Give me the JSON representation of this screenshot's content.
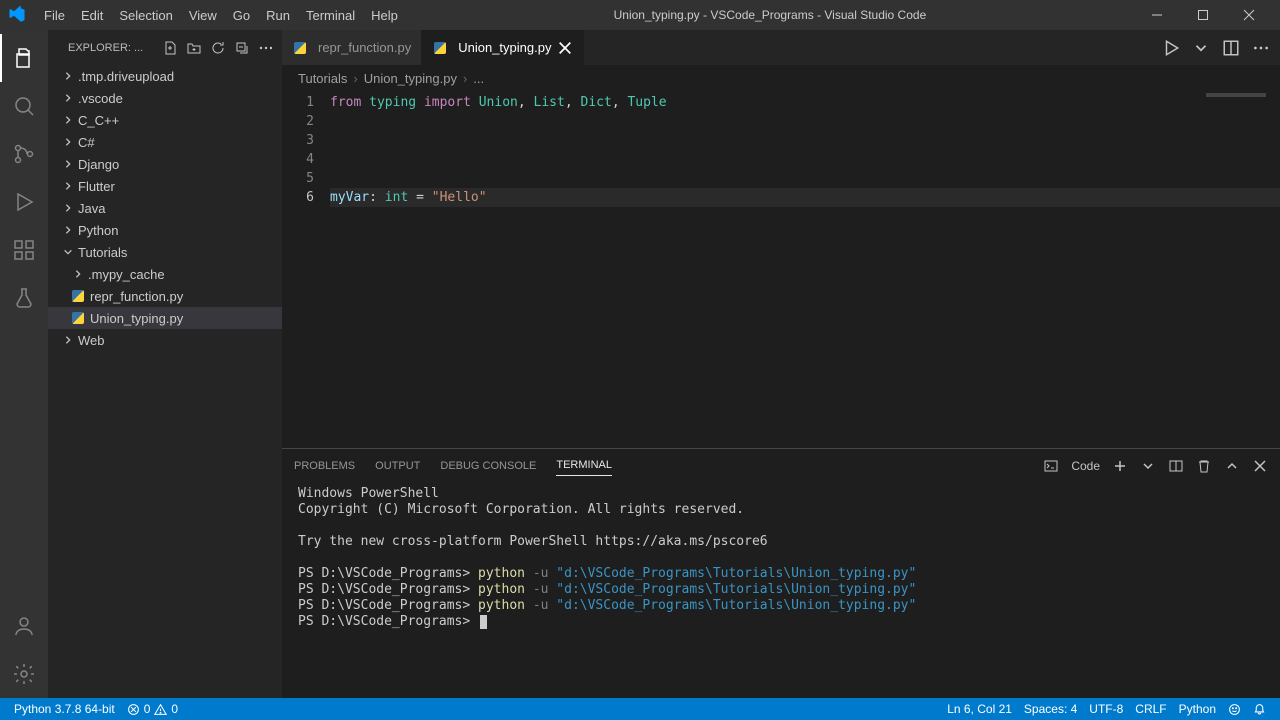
{
  "window": {
    "title": "Union_typing.py - VSCode_Programs - Visual Studio Code"
  },
  "menu": [
    "File",
    "Edit",
    "Selection",
    "View",
    "Go",
    "Run",
    "Terminal",
    "Help"
  ],
  "explorer": {
    "title": "EXPLORER: ...",
    "items": [
      {
        "label": ".tmp.driveupload",
        "type": "folder",
        "depth": 0,
        "expanded": false
      },
      {
        "label": ".vscode",
        "type": "folder",
        "depth": 0,
        "expanded": false
      },
      {
        "label": "C_C++",
        "type": "folder",
        "depth": 0,
        "expanded": false
      },
      {
        "label": "C#",
        "type": "folder",
        "depth": 0,
        "expanded": false
      },
      {
        "label": "Django",
        "type": "folder",
        "depth": 0,
        "expanded": false
      },
      {
        "label": "Flutter",
        "type": "folder",
        "depth": 0,
        "expanded": false
      },
      {
        "label": "Java",
        "type": "folder",
        "depth": 0,
        "expanded": false
      },
      {
        "label": "Python",
        "type": "folder",
        "depth": 0,
        "expanded": false
      },
      {
        "label": "Tutorials",
        "type": "folder",
        "depth": 0,
        "expanded": true
      },
      {
        "label": ".mypy_cache",
        "type": "folder",
        "depth": 1,
        "expanded": false
      },
      {
        "label": "repr_function.py",
        "type": "file-py",
        "depth": 1
      },
      {
        "label": "Union_typing.py",
        "type": "file-py",
        "depth": 1,
        "selected": true
      },
      {
        "label": "Web",
        "type": "folder",
        "depth": 0,
        "expanded": false
      }
    ]
  },
  "tabs": [
    {
      "label": "repr_function.py",
      "active": false,
      "icon": "py"
    },
    {
      "label": "Union_typing.py",
      "active": true,
      "icon": "py"
    }
  ],
  "breadcrumbs": [
    "Tutorials",
    "Union_typing.py",
    "..."
  ],
  "code": {
    "lines": [
      {
        "n": 1,
        "tokens": [
          [
            "from",
            "kw"
          ],
          [
            " ",
            "p"
          ],
          [
            "typing",
            "mod"
          ],
          [
            " ",
            "p"
          ],
          [
            "import",
            "kw"
          ],
          [
            " ",
            "p"
          ],
          [
            "Union",
            "mod"
          ],
          [
            ", ",
            "p"
          ],
          [
            "List",
            "mod"
          ],
          [
            ", ",
            "p"
          ],
          [
            "Dict",
            "mod"
          ],
          [
            ", ",
            "p"
          ],
          [
            "Tuple",
            "mod"
          ]
        ]
      },
      {
        "n": 2,
        "tokens": []
      },
      {
        "n": 3,
        "tokens": []
      },
      {
        "n": 4,
        "tokens": []
      },
      {
        "n": 5,
        "tokens": []
      },
      {
        "n": 6,
        "active": true,
        "tokens": [
          [
            "myVar",
            "var"
          ],
          [
            ": ",
            "p"
          ],
          [
            "int",
            "builtin"
          ],
          [
            " = ",
            "p"
          ],
          [
            "\"Hello\"",
            "str"
          ]
        ]
      }
    ]
  },
  "panel": {
    "tabs": [
      "PROBLEMS",
      "OUTPUT",
      "DEBUG CONSOLE",
      "TERMINAL"
    ],
    "activeTab": "TERMINAL",
    "profile": "Code",
    "terminal": {
      "prelude": [
        "Windows PowerShell",
        "Copyright (C) Microsoft Corporation. All rights reserved.",
        "",
        "Try the new cross-platform PowerShell https://aka.ms/pscore6",
        ""
      ],
      "prompt": "PS D:\\VSCode_Programs>",
      "cmd": "python",
      "flag": "-u",
      "arg": "\"d:\\VSCode_Programs\\Tutorials\\Union_typing.py\"",
      "repeat": 3
    }
  },
  "status": {
    "left": {
      "python": "Python 3.7.8 64-bit",
      "errors": "0",
      "warnings": "0"
    },
    "right": {
      "pos": "Ln 6, Col 21",
      "spaces": "Spaces: 4",
      "enc": "UTF-8",
      "eol": "CRLF",
      "lang": "Python"
    }
  }
}
